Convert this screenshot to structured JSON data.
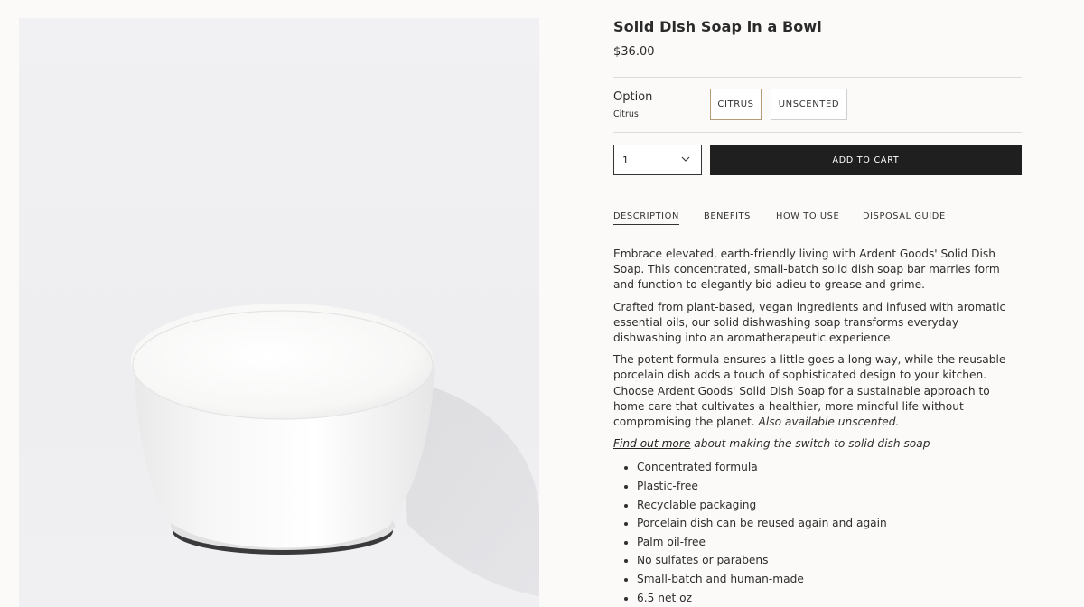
{
  "product": {
    "title": "Solid Dish Soap in a Bowl",
    "price": "$36.00",
    "image_alt": "white porcelain bowl with solid dish soap"
  },
  "option": {
    "label": "Option",
    "selected": "Citrus",
    "choices": [
      "CITRUS",
      "UNSCENTED"
    ]
  },
  "purchase": {
    "quantity": "1",
    "add_to_cart": "ADD TO CART"
  },
  "tabs": [
    "DESCRIPTION",
    "BENEFITS",
    "HOW TO USE",
    "DISPOSAL GUIDE"
  ],
  "description": {
    "p1_lines": [
      "Embrace elevated, earth-friendly living with Ardent Goods' Solid Dish",
      "Soap. This concentrated, small-batch solid dish soap bar marries form",
      "and function to elegantly bid adieu to grease and grime."
    ],
    "p2_lines": [
      "Crafted from plant-based, vegan ingredients and infused with aromatic",
      "essential oils, our solid dishwashing soap transforms everyday",
      "dishwashing into an aromatherapeutic experience."
    ],
    "p3_lines": [
      "The potent formula ensures a little goes a long way, while the reusable",
      "porcelain dish adds a touch of sophisticated design to your kitchen.",
      "Choose Ardent Goods' Solid Dish Soap for a sustainable approach to",
      "home care that cultivates a healthier, more mindful life without"
    ],
    "p3_last": "compromising the planet.",
    "p3_italic": "Also available unscented.",
    "link_text": "Find out more",
    "link_suffix": "about making the switch to solid dish soap",
    "features": [
      "Concentrated formula",
      "Plastic-free",
      "Recyclable packaging",
      "Porcelain dish can be reused again and again",
      "Palm oil-free",
      "No sulfates or parabens",
      "Small-batch and human-made",
      "6.5 net oz"
    ]
  }
}
